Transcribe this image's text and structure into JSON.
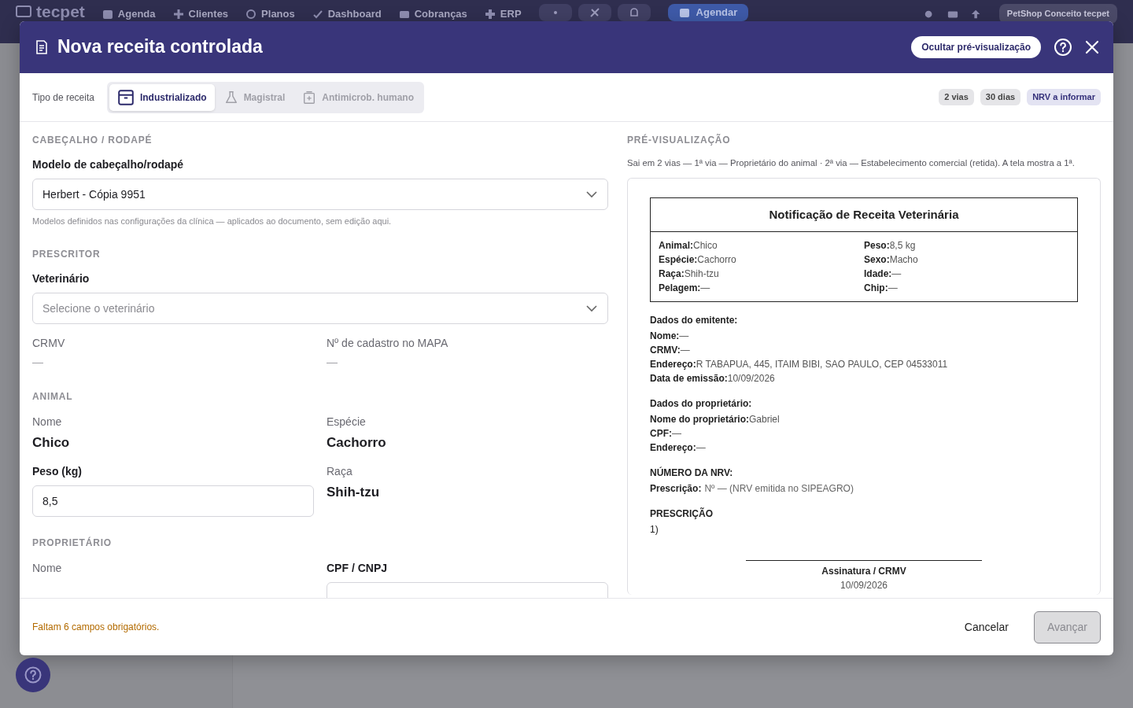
{
  "topbar": {
    "logo": "tecpet",
    "nav": [
      "Agenda",
      "Clientes",
      "Planos",
      "Dashboard",
      "Cobranças",
      "ERP"
    ],
    "cta": "Agendar",
    "account": "PetShop Conceito tecpet"
  },
  "modal": {
    "title": "Nova receita controlada",
    "preview_toggle": "Ocultar pré-visualização",
    "type_label": "Tipo de receita",
    "tabs": [
      {
        "label": "Industrializado",
        "kind": "box",
        "selected": true
      },
      {
        "label": "Magistral",
        "kind": "flask",
        "selected": false
      },
      {
        "label": "Antimicrob. humano",
        "kind": "medkit",
        "selected": false
      }
    ],
    "badges": [
      {
        "label": "2 vias",
        "kind": "neutral"
      },
      {
        "label": "30 dias",
        "kind": "neutral"
      },
      {
        "label": "NRV a informar",
        "kind": "info"
      }
    ],
    "sections": [
      {
        "title": "CABEÇALHO / RODAPÉ",
        "rows": [
          [
            {
              "kind": "select",
              "label": "Modelo de cabeçalho/rodapé",
              "value": "Herbert - Cópia 9951",
              "hint": "Modelos definidos nas configurações da clínica — aplicados ao documento, sem edição aqui."
            }
          ]
        ]
      },
      {
        "title": "PRESCRITOR",
        "rows": [
          [
            {
              "kind": "select",
              "label": "Veterinário",
              "placeholder": "Selecione o veterinário"
            }
          ],
          [
            {
              "kind": "info",
              "label": "CRMV",
              "value": "—",
              "muted": true
            },
            {
              "kind": "info",
              "label": "Nº de cadastro no MAPA",
              "value": "—",
              "muted": true
            }
          ]
        ]
      },
      {
        "title": "ANIMAL",
        "rows": [
          [
            {
              "kind": "info",
              "label": "Nome",
              "value": "Chico",
              "muted": false
            },
            {
              "kind": "info",
              "label": "Espécie",
              "value": "Cachorro",
              "muted": false
            }
          ],
          [
            {
              "kind": "input",
              "label": "Peso (kg)",
              "value": "8,5"
            },
            {
              "kind": "info",
              "label": "Raça",
              "value": "Shih-tzu",
              "muted": false
            }
          ]
        ]
      },
      {
        "title": "PROPRIETÁRIO",
        "rows": [
          [
            {
              "kind": "info",
              "label": "Nome"
            },
            {
              "kind": "input",
              "label": "CPF / CNPJ"
            }
          ]
        ]
      }
    ],
    "preview": {
      "title": "PRÉ-VISUALIZAÇÃO",
      "note": "Sai em 2 vias — 1ª via — Proprietário do animal · 2ª via — Estabelecimento comercial (retida). A tela mostra a 1ª.",
      "doc_title": "Notificação de Receita Veterinária",
      "pet_fields": [
        {
          "label": "Animal:",
          "value": "Chico"
        },
        {
          "label": "Peso:",
          "value": "8,5 kg"
        },
        {
          "label": "Espécie:",
          "value": "Cachorro"
        },
        {
          "label": "Sexo:",
          "value": "Macho"
        },
        {
          "label": "Raça:",
          "value": "Shih-tzu"
        },
        {
          "label": "Idade:",
          "value": "—"
        },
        {
          "label": "Pelagem:",
          "value": "—"
        },
        {
          "label": "Chip:",
          "value": "—"
        }
      ],
      "blocks": [
        {
          "kind": "fields",
          "heading": "Dados do emitente:",
          "lines": [
            {
              "label": "Nome:",
              "value": "—"
            },
            {
              "label": "CRMV:",
              "value": "—"
            },
            {
              "label": "Endereço:",
              "value": "R TABAPUA, 445, ITAIM BIBI, SAO PAULO, CEP 04533011"
            },
            {
              "label": "Data de emissão:",
              "value": "10/09/2026"
            }
          ]
        },
        {
          "kind": "fields",
          "heading": "Dados do proprietário:",
          "lines": [
            {
              "label": "Nome do proprietário:",
              "value": "Gabriel"
            },
            {
              "label": "CPF:",
              "value": "—"
            },
            {
              "label": "Endereço:",
              "value": "—"
            }
          ]
        },
        {
          "kind": "nrv",
          "heading": "NÚMERO DA NRV:",
          "lines": [
            {
              "label": "Prescrição:",
              "value": "Nº — (NRV emitida no SIPEAGRO)"
            }
          ]
        },
        {
          "kind": "list",
          "heading": "PRESCRIÇÃO",
          "lines": [
            {
              "value": "1)"
            }
          ]
        }
      ],
      "signature": {
        "label": "Assinatura / CRMV",
        "date": "10/09/2026"
      }
    },
    "footer": {
      "warning": "Faltam 6 campos obrigatórios.",
      "cancel": "Cancelar",
      "next": "Avançar",
      "next_disabled": true
    }
  }
}
